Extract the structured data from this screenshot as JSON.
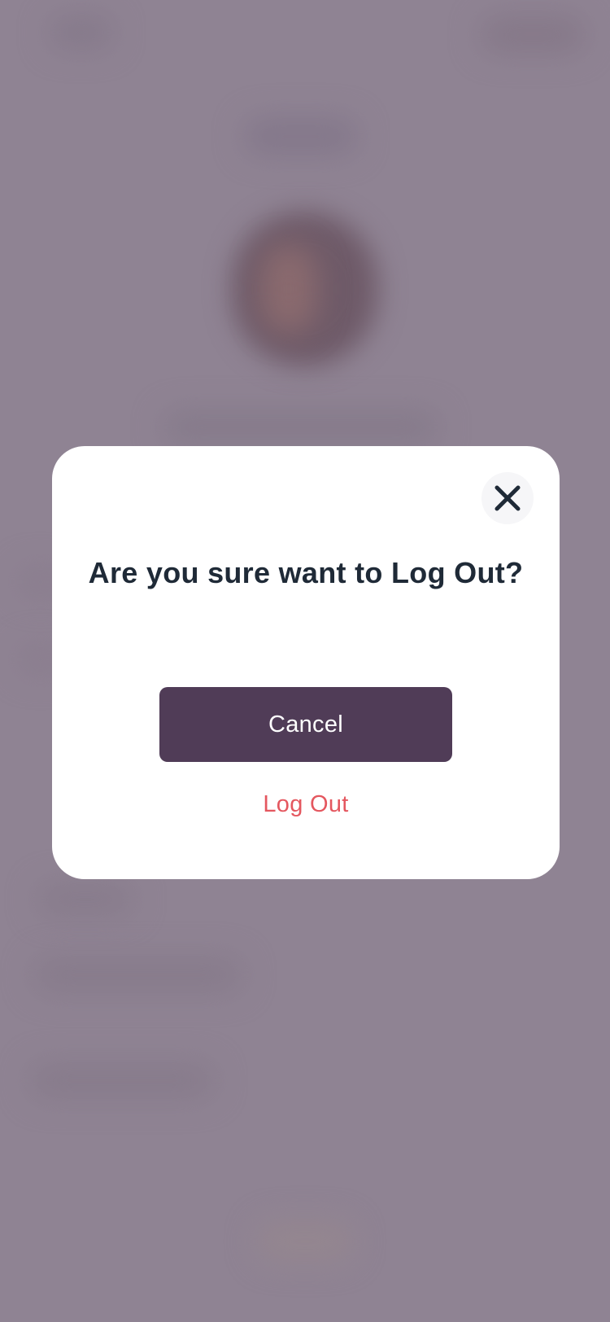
{
  "background": {
    "overlay_color": "#8f8393"
  },
  "dialog": {
    "title": "Are you sure want to Log Out?",
    "cancel_label": "Cancel",
    "logout_label": "Log Out",
    "close_icon": "close-icon"
  },
  "colors": {
    "primary_button": "#503c57",
    "danger_text": "#e4575f",
    "title_text": "#1f2a37"
  }
}
